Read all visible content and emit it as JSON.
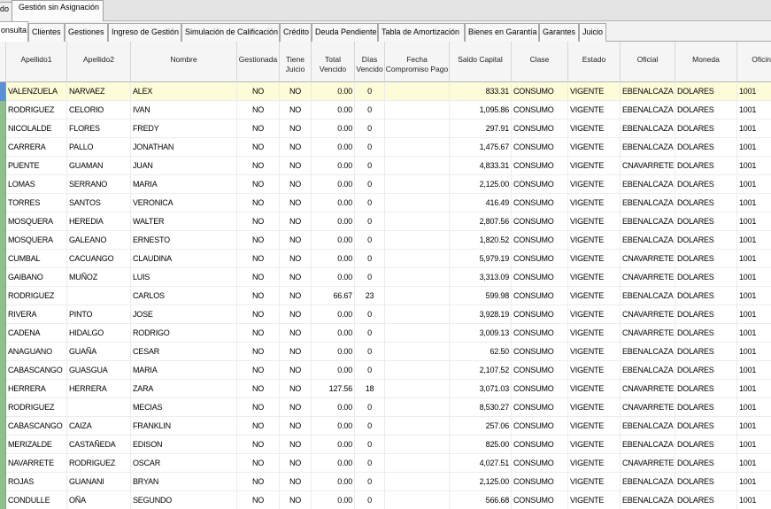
{
  "top_tabs": [
    "ido",
    "Gestión sin Asignación"
  ],
  "inner_tabs": [
    {
      "label": "onsulta",
      "active": true
    },
    {
      "label": "Clientes"
    },
    {
      "label": "Gestiones"
    },
    {
      "label": "Ingreso de Gestión"
    },
    {
      "label": "Simulación de Calificación"
    },
    {
      "label": "Crédito"
    },
    {
      "label": "Deuda Pendiente"
    },
    {
      "label": "Tabla de Amortización"
    },
    {
      "label": "Bienes en Garantía"
    },
    {
      "label": "Garantes"
    },
    {
      "label": "Juicio"
    }
  ],
  "columns": [
    {
      "key": "apellido1",
      "label": "Apellido1"
    },
    {
      "key": "apellido2",
      "label": "Apellido2"
    },
    {
      "key": "nombre",
      "label": "Nombre"
    },
    {
      "key": "gestionada",
      "label": "Gestionada"
    },
    {
      "key": "tiene_juicio",
      "label": "Tiene Juicio"
    },
    {
      "key": "total_vencido",
      "label": "Total Vencido"
    },
    {
      "key": "dias_vencido",
      "label": "Días Vencido"
    },
    {
      "key": "fecha_compromiso",
      "label": "Fecha Compromiso Pago"
    },
    {
      "key": "saldo_capital",
      "label": "Saldo Capital"
    },
    {
      "key": "clase",
      "label": "Clase"
    },
    {
      "key": "estado",
      "label": "Estado"
    },
    {
      "key": "oficial",
      "label": "Oficial"
    },
    {
      "key": "moneda",
      "label": "Moneda"
    },
    {
      "key": "oficina",
      "label": "Oficina"
    }
  ],
  "rows": [
    [
      "VALENZUELA",
      "NARVAEZ",
      "ALEX",
      "NO",
      "NO",
      "0.00",
      "0",
      "",
      "833.31",
      "CONSUMO",
      "VIGENTE",
      "EBENALCAZA",
      "DOLARES",
      "1001"
    ],
    [
      "RODRIGUEZ",
      "CELORIO",
      "IVAN",
      "NO",
      "NO",
      "0.00",
      "0",
      "",
      "1,095.86",
      "CONSUMO",
      "VIGENTE",
      "EBENALCAZA",
      "DOLARES",
      "1001"
    ],
    [
      "NICOLALDE",
      "FLORES",
      "FREDY",
      "NO",
      "NO",
      "0.00",
      "0",
      "",
      "297.91",
      "CONSUMO",
      "VIGENTE",
      "EBENALCAZA",
      "DOLARES",
      "1001"
    ],
    [
      "CARRERA",
      "PALLO",
      "JONATHAN",
      "NO",
      "NO",
      "0.00",
      "0",
      "",
      "1,475.67",
      "CONSUMO",
      "VIGENTE",
      "EBENALCAZA",
      "DOLARES",
      "1001"
    ],
    [
      "PUENTE",
      "GUAMAN",
      "JUAN",
      "NO",
      "NO",
      "0.00",
      "0",
      "",
      "4,833.31",
      "CONSUMO",
      "VIGENTE",
      "CNAVARRETE",
      "DOLARES",
      "1001"
    ],
    [
      "LOMAS",
      "SERRANO",
      "MARIA",
      "NO",
      "NO",
      "0.00",
      "0",
      "",
      "2,125.00",
      "CONSUMO",
      "VIGENTE",
      "EBENALCAZA",
      "DOLARES",
      "1001"
    ],
    [
      "TORRES",
      "SANTOS",
      "VERONICA",
      "NO",
      "NO",
      "0.00",
      "0",
      "",
      "416.49",
      "CONSUMO",
      "VIGENTE",
      "EBENALCAZA",
      "DOLARES",
      "1001"
    ],
    [
      "MOSQUERA",
      "HEREDIA",
      "WALTER",
      "NO",
      "NO",
      "0.00",
      "0",
      "",
      "2,807.56",
      "CONSUMO",
      "VIGENTE",
      "EBENALCAZA",
      "DOLARES",
      "1001"
    ],
    [
      "MOSQUERA",
      "GALEANO",
      "ERNESTO",
      "NO",
      "NO",
      "0.00",
      "0",
      "",
      "1,820.52",
      "CONSUMO",
      "VIGENTE",
      "EBENALCAZA",
      "DOLARES",
      "1001"
    ],
    [
      "CUMBAL",
      "CACUANGO",
      "CLAUDINA",
      "NO",
      "NO",
      "0.00",
      "0",
      "",
      "5,979.19",
      "CONSUMO",
      "VIGENTE",
      "CNAVARRETE",
      "DOLARES",
      "1001"
    ],
    [
      "GAIBANO",
      "MUÑOZ",
      "LUIS",
      "NO",
      "NO",
      "0.00",
      "0",
      "",
      "3,313.09",
      "CONSUMO",
      "VIGENTE",
      "CNAVARRETE",
      "DOLARES",
      "1001"
    ],
    [
      "RODRIGUEZ",
      "",
      "CARLOS",
      "NO",
      "NO",
      "66.67",
      "23",
      "",
      "599.98",
      "CONSUMO",
      "VIGENTE",
      "EBENALCAZA",
      "DOLARES",
      "1001"
    ],
    [
      "RIVERA",
      "PINTO",
      "JOSE",
      "NO",
      "NO",
      "0.00",
      "0",
      "",
      "3,928.19",
      "CONSUMO",
      "VIGENTE",
      "CNAVARRETE",
      "DOLARES",
      "1001"
    ],
    [
      "CADENA",
      "HIDALGO",
      "RODRIGO",
      "NO",
      "NO",
      "0.00",
      "0",
      "",
      "3,009.13",
      "CONSUMO",
      "VIGENTE",
      "CNAVARRETE",
      "DOLARES",
      "1001"
    ],
    [
      "ANAGUANO",
      "GUAÑA",
      "CESAR",
      "NO",
      "NO",
      "0.00",
      "0",
      "",
      "62.50",
      "CONSUMO",
      "VIGENTE",
      "EBENALCAZA",
      "DOLARES",
      "1001"
    ],
    [
      "CABASCANGO",
      "GUASGUA",
      "MARIA",
      "NO",
      "NO",
      "0.00",
      "0",
      "",
      "2,107.52",
      "CONSUMO",
      "VIGENTE",
      "EBENALCAZA",
      "DOLARES",
      "1001"
    ],
    [
      "HERRERA",
      "HERRERA",
      "ZARA",
      "NO",
      "NO",
      "127.56",
      "18",
      "",
      "3,071.03",
      "CONSUMO",
      "VIGENTE",
      "CNAVARRETE",
      "DOLARES",
      "1001"
    ],
    [
      "RODRIGUEZ",
      "",
      "MECIAS",
      "NO",
      "NO",
      "0.00",
      "0",
      "",
      "8,530.27",
      "CONSUMO",
      "VIGENTE",
      "CNAVARRETE",
      "DOLARES",
      "1001"
    ],
    [
      "CABASCANGO",
      "CAIZA",
      "FRANKLIN",
      "NO",
      "NO",
      "0.00",
      "0",
      "",
      "257.06",
      "CONSUMO",
      "VIGENTE",
      "EBENALCAZA",
      "DOLARES",
      "1001"
    ],
    [
      "MERIZALDE",
      "CASTAÑEDA",
      "EDISON",
      "NO",
      "NO",
      "0.00",
      "0",
      "",
      "825.00",
      "CONSUMO",
      "VIGENTE",
      "EBENALCAZA",
      "DOLARES",
      "1001"
    ],
    [
      "NAVARRETE",
      "RODRIGUEZ",
      "OSCAR",
      "NO",
      "NO",
      "0.00",
      "0",
      "",
      "4,027.51",
      "CONSUMO",
      "VIGENTE",
      "CNAVARRETE",
      "DOLARES",
      "1001"
    ],
    [
      "ROJAS",
      "GUANANI",
      "BRYAN",
      "NO",
      "NO",
      "0.00",
      "0",
      "",
      "2,125.00",
      "CONSUMO",
      "VIGENTE",
      "EBENALCAZA",
      "DOLARES",
      "1001"
    ],
    [
      "CONDULLE",
      "OÑA",
      "SEGUNDO",
      "NO",
      "NO",
      "0.00",
      "0",
      "",
      "566.68",
      "CONSUMO",
      "VIGENTE",
      "EBENALCAZA",
      "DOLARES",
      "1001"
    ]
  ],
  "selected_row": 0,
  "colors": {
    "selected_row_bg": "#fcfcd8",
    "row_header": "#8fbf8f",
    "row_header_selected": "#5b8fd6"
  }
}
